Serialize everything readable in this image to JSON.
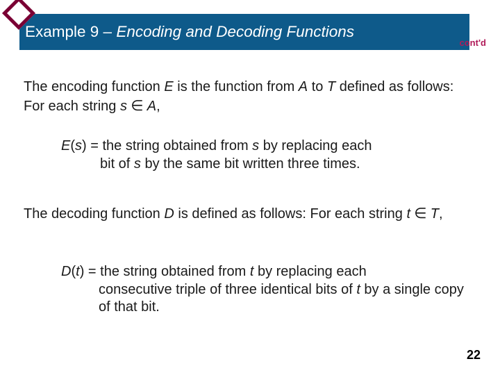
{
  "title": {
    "prefix": "Example 9 – ",
    "main": "Encoding and Decoding Functions"
  },
  "contd": "cont'd",
  "para1": {
    "t1": "The encoding function ",
    "E": "E",
    "t2": " is the function from ",
    "A": "A",
    "t3": " to ",
    "T": "T",
    "t4": " defined as follows: For each string ",
    "s": "s",
    "elem": " ∈ ",
    "A2": "A",
    "comma": ","
  },
  "para2": {
    "Es": "E",
    "paren_s": "(s)",
    "t1": " = the string obtained from ",
    "s": "s",
    "t2": " by replacing each",
    "line2a": "bit of ",
    "s2": "s",
    "line2b": " by the same bit written three times."
  },
  "para3": {
    "t1": "The decoding function ",
    "D": "D",
    "t2": " is defined as follows: For each string ",
    "tvar": "t",
    "elem": " ∈ ",
    "T": "T",
    "comma": ","
  },
  "para4": {
    "Dt": "D",
    "paren_t": "(t)",
    "t1": " = the string obtained from ",
    "tvar": "t",
    "t2": " by replacing each",
    "line2a": "consecutive triple of three identical bits of ",
    "tvar2": "t",
    "line2b": " by a single copy of that bit."
  },
  "page_number": "22"
}
